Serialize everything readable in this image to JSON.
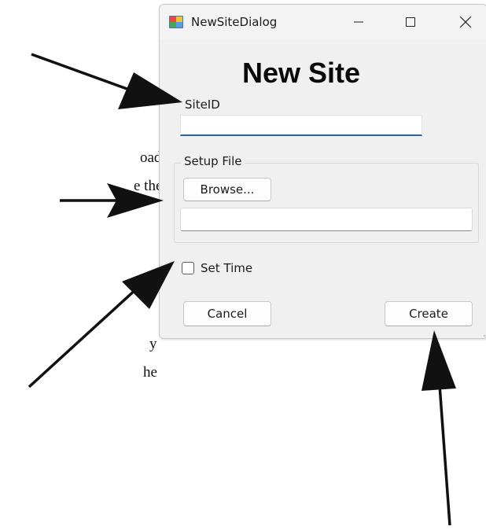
{
  "window": {
    "title": "NewSiteDialog",
    "controls": {
      "minimize": "–",
      "maximize": "☐",
      "close": "✕"
    }
  },
  "dialog": {
    "heading": "New Site",
    "siteid_label": "SiteID",
    "siteid_value": "",
    "setup_group_label": "Setup File",
    "browse_label": "Browse...",
    "setup_file_value": "",
    "set_time_label": "Set Time",
    "set_time_checked": false,
    "cancel_label": "Cancel",
    "create_label": "Create"
  },
  "document_fragments": [
    "oad.",
    "e the",
    "y",
    "he"
  ],
  "icons": {
    "app": "winforms-app-icon",
    "minimize": "minimize-icon",
    "maximize": "maximize-icon",
    "close": "close-icon"
  },
  "colors": {
    "window_bg": "#f0f0f0",
    "focus_underline": "#1f66b5",
    "arrow": "#111111"
  }
}
